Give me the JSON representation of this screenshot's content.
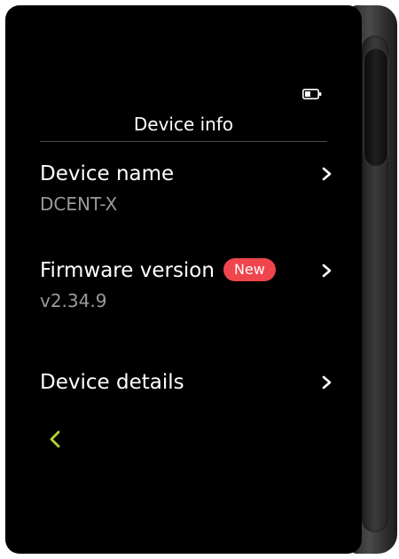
{
  "screen": {
    "title": "Device info"
  },
  "status": {
    "battery_icon": "battery-low-icon"
  },
  "menu": {
    "items": [
      {
        "label": "Device name",
        "value": "DCENT-X",
        "icon": "chevron-right-icon"
      },
      {
        "label": "Firmware version",
        "badge": "New",
        "value": "v2.34.9",
        "icon": "chevron-right-icon"
      },
      {
        "label": "Device details",
        "icon": "chevron-right-icon"
      }
    ]
  },
  "navigation": {
    "back_icon": "chevron-left-icon"
  },
  "colors": {
    "background": "#000000",
    "text": "#ffffff",
    "secondary_text": "#9a9a9a",
    "badge": "#f0454d",
    "back_accent": "#b5d334",
    "divider": "#4a4a4a"
  }
}
